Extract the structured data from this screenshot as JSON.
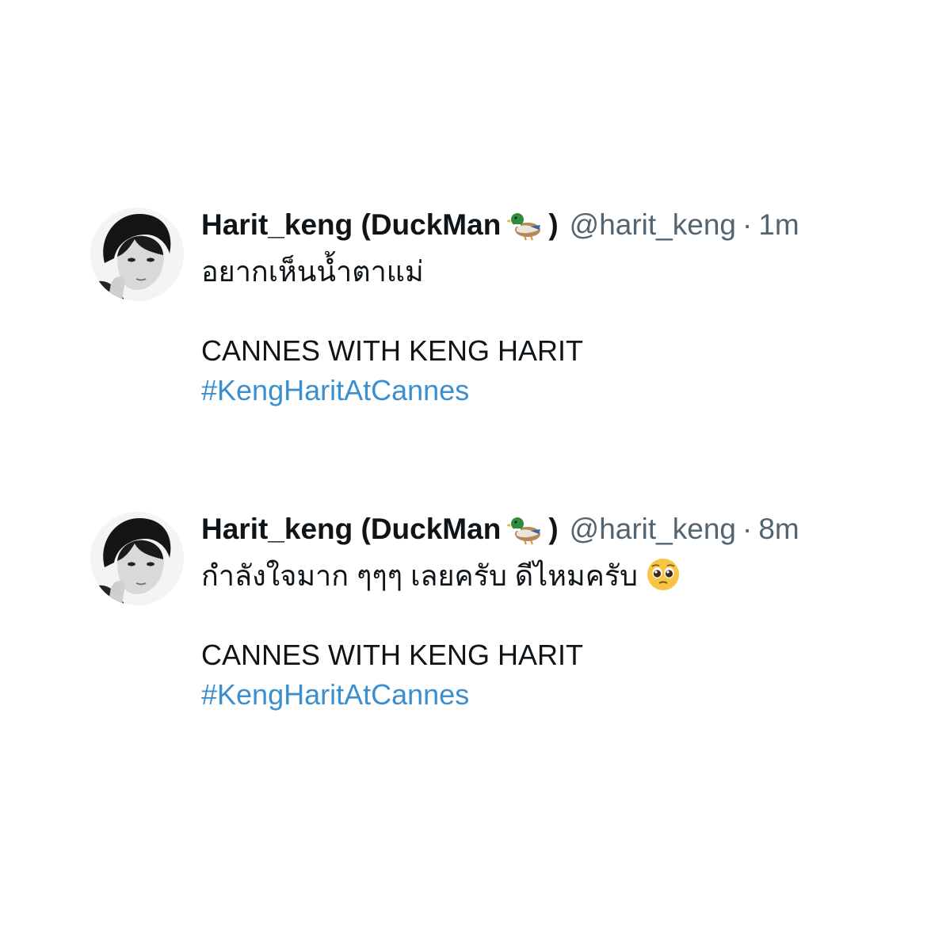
{
  "tweets": [
    {
      "display_name": "Harit_keng (DuckMan",
      "display_name_close": ")",
      "name_emoji": "duck-icon",
      "handle": "@harit_keng",
      "separator": "·",
      "time": "1m",
      "text_thai": "อยากเห็นน้ำตาแม่",
      "text_line2": "CANNES WITH KENG HARIT",
      "hashtag": "#KengHaritAtCannes"
    },
    {
      "display_name": "Harit_keng (DuckMan",
      "display_name_close": ")",
      "name_emoji": "duck-icon",
      "handle": "@harit_keng",
      "separator": "·",
      "time": "8m",
      "text_thai": "กำลังใจมาก ๆๆๆ เลยครับ ดีไหมครับ",
      "trailing_emoji": "pleading-face-icon",
      "text_line2": "CANNES WITH KENG HARIT",
      "hashtag": "#KengHaritAtCannes"
    }
  ],
  "colors": {
    "text": "#0f1419",
    "muted": "#536471",
    "hashtag": "#3a8fd1",
    "background": "#ffffff"
  }
}
